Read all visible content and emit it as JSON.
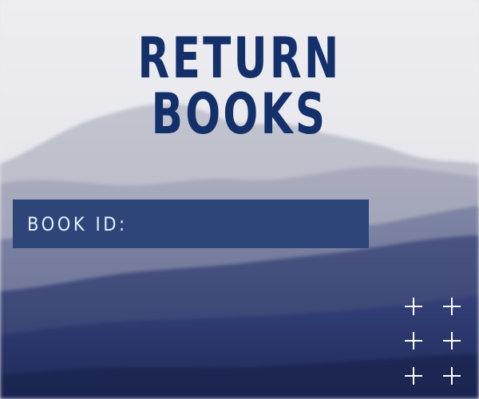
{
  "page": {
    "title": "RETURN BOOKS"
  },
  "form": {
    "book_id_label": "BOOK ID:",
    "book_id_value": ""
  },
  "decoration": {
    "icon": "plus-icon",
    "count": 6
  },
  "colors": {
    "title": "#14306a",
    "field_background": "#2e4579",
    "field_text": "#e8ecf6",
    "page_background": "#e9e9ee",
    "mountain_dark": "#2b3a66"
  }
}
